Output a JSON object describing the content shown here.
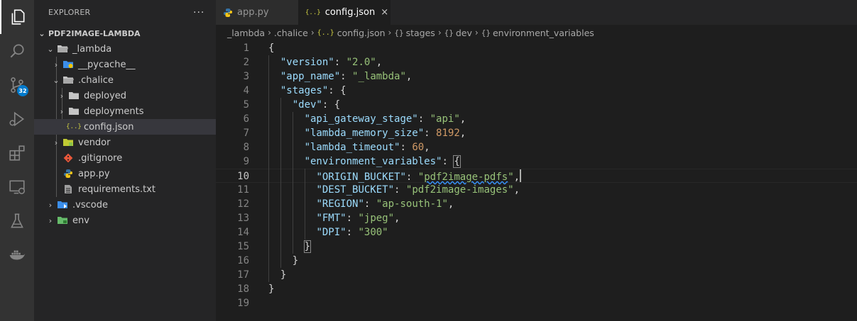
{
  "activity_bar": {
    "items": [
      "explorer-icon",
      "search-icon",
      "source-control-icon",
      "run-debug-icon",
      "extensions-icon",
      "remote-explorer-icon",
      "testing-icon",
      "docker-icon"
    ],
    "scm_badge": "32"
  },
  "sidebar": {
    "title": "EXPLORER",
    "more": "...",
    "root": "PDF2IMAGE-LAMBDA",
    "tree": [
      {
        "label": "_lambda",
        "kind": "folder-open",
        "depth": 1,
        "chevron": "open"
      },
      {
        "label": "__pycache__",
        "kind": "folder-python",
        "depth": 2,
        "chevron": "closed"
      },
      {
        "label": ".chalice",
        "kind": "folder-open",
        "depth": 2,
        "chevron": "open"
      },
      {
        "label": "deployed",
        "kind": "folder",
        "depth": 3,
        "chevron": "closed"
      },
      {
        "label": "deployments",
        "kind": "folder",
        "depth": 3,
        "chevron": "closed"
      },
      {
        "label": "config.json",
        "kind": "json",
        "depth": 3,
        "chevron": "none",
        "selected": true
      },
      {
        "label": "vendor",
        "kind": "folder-vendor",
        "depth": 2,
        "chevron": "closed"
      },
      {
        "label": ".gitignore",
        "kind": "git",
        "depth": 2,
        "chevron": "none"
      },
      {
        "label": "app.py",
        "kind": "python",
        "depth": 2,
        "chevron": "none"
      },
      {
        "label": "requirements.txt",
        "kind": "text",
        "depth": 2,
        "chevron": "none"
      },
      {
        "label": ".vscode",
        "kind": "folder-vscode",
        "depth": 1,
        "chevron": "closed"
      },
      {
        "label": "env",
        "kind": "folder-env",
        "depth": 1,
        "chevron": "closed"
      }
    ]
  },
  "tabs": [
    {
      "label": "app.py",
      "icon": "python-icon",
      "active": false
    },
    {
      "label": "config.json",
      "icon": "json-icon",
      "active": true,
      "close": "×"
    }
  ],
  "breadcrumb": {
    "items": [
      "_lambda",
      ".chalice",
      "config.json",
      "stages",
      "dev",
      "environment_variables"
    ],
    "separator": "›",
    "json_icon": "{..}",
    "object_icon": "{}"
  },
  "editor": {
    "current_line": 10,
    "lines": [
      "{",
      "  \"version\": \"2.0\",",
      "  \"app_name\": \"_lambda\",",
      "  \"stages\": {",
      "    \"dev\": {",
      "      \"api_gateway_stage\": \"api\",",
      "      \"lambda_memory_size\": 8192,",
      "      \"lambda_timeout\": 60,",
      "      \"environment_variables\": {",
      "        \"ORIGIN_BUCKET\": \"pdf2image-pdfs\",",
      "        \"DEST_BUCKET\": \"pdf2image-images\",",
      "        \"REGION\": \"ap-south-1\",",
      "        \"FMT\": \"jpeg\",",
      "        \"DPI\": \"300\"",
      "      }",
      "    }",
      "  }",
      "}",
      ""
    ]
  },
  "colors": {
    "activity_bg": "#333333",
    "sidebar_bg": "#252526",
    "editor_bg": "#1e1e1e",
    "json_key": "#9cdcfe",
    "json_string": "#98c379",
    "json_number": "#ce9178",
    "folder": "#c5c5c5",
    "json_icon": "#cbcb41",
    "python_icon": "#3572a5"
  }
}
